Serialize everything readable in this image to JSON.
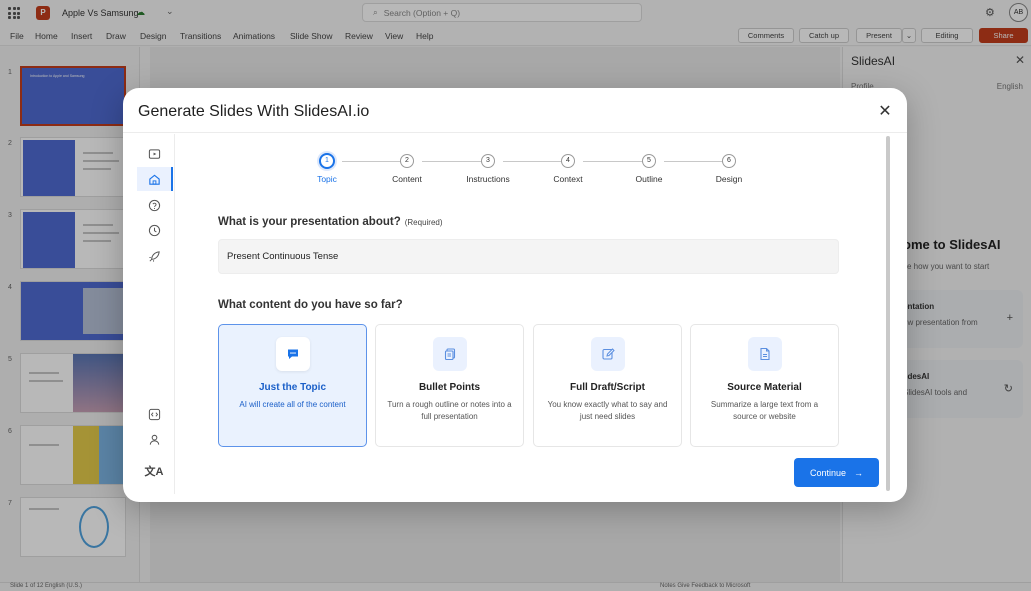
{
  "titlebar": {
    "doc_title": "Apple Vs Samsung",
    "search_placeholder": "Search (Option + Q)",
    "avatar_initials": "AB"
  },
  "menubar": {
    "items": [
      "File",
      "Home",
      "Insert",
      "Draw",
      "Design",
      "Transitions",
      "Animations",
      "Slide Show",
      "Review",
      "View",
      "Help"
    ],
    "comments": "Comments",
    "catch_up": "Catch up",
    "present": "Present",
    "editing": "Editing",
    "share": "Share"
  },
  "thumbnails": {
    "numbers": [
      "1",
      "2",
      "3",
      "4",
      "5",
      "6",
      "7"
    ],
    "slide1_title": "Introduction to Apple and Samsung"
  },
  "side_pane": {
    "title": "SlidesAI",
    "profile": "Profile",
    "language": "English",
    "welcome": "ome to SlidesAI",
    "welcome_sub": "e how you want to start",
    "card1_title": "entation",
    "card1_desc": "ew presentation from",
    "card2_title": "lidesAI",
    "card2_desc": "SlidesAI tools and"
  },
  "statusbar": {
    "left": "Slide 1 of 12    English (U.S.)",
    "right": "Notes    Give Feedback to Microsoft"
  },
  "modal": {
    "title": "Generate Slides With SlidesAI.io",
    "steps": [
      {
        "num": "1",
        "label": "Topic"
      },
      {
        "num": "2",
        "label": "Content"
      },
      {
        "num": "3",
        "label": "Instructions"
      },
      {
        "num": "4",
        "label": "Context"
      },
      {
        "num": "5",
        "label": "Outline"
      },
      {
        "num": "6",
        "label": "Design"
      }
    ],
    "question1": "What is your presentation about?",
    "question1_required": "(Required)",
    "topic_value": "Present Continuous Tense",
    "question2": "What content do you have so far?",
    "options": [
      {
        "title": "Just the Topic",
        "desc": "AI will create all of the content"
      },
      {
        "title": "Bullet Points",
        "desc": "Turn a rough outline or notes into a full presentation"
      },
      {
        "title": "Full Draft/Script",
        "desc": "You know exactly what to say and just need slides"
      },
      {
        "title": "Source Material",
        "desc": "Summarize a large text from a source or website"
      }
    ],
    "continue_label": "Continue",
    "close_glyph": "✕",
    "arrow_glyph": "→"
  },
  "colors": {
    "accent": "#1a73e8",
    "selected_bg": "#eaf2fe",
    "ppt_brand": "#c43e1c"
  }
}
